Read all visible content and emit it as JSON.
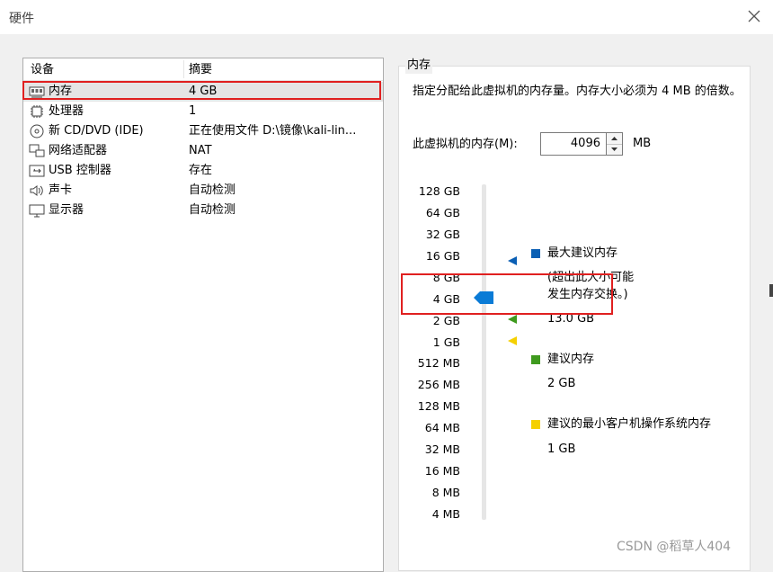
{
  "window": {
    "title": "硬件",
    "close_glyph": "✕"
  },
  "device_list": {
    "col_device": "设备",
    "col_summary": "摘要",
    "items": [
      {
        "name": "内存",
        "summary": "4 GB",
        "icon": "memory-icon"
      },
      {
        "name": "处理器",
        "summary": "1",
        "icon": "processor-icon"
      },
      {
        "name": "新 CD/DVD (IDE)",
        "summary": "正在使用文件 D:\\镜像\\kali-lin...",
        "icon": "cd-dvd-icon"
      },
      {
        "name": "网络适配器",
        "summary": "NAT",
        "icon": "network-icon"
      },
      {
        "name": "USB 控制器",
        "summary": "存在",
        "icon": "usb-icon"
      },
      {
        "name": "声卡",
        "summary": "自动检测",
        "icon": "speaker-icon"
      },
      {
        "name": "显示器",
        "summary": "自动检测",
        "icon": "monitor-icon"
      }
    ]
  },
  "memory": {
    "group_title": "内存",
    "description": "指定分配给此虚拟机的内存量。内存大小必须为 4 MB 的倍数。",
    "field_label": "此虚拟机的内存(M):",
    "value": "4096",
    "unit": "MB",
    "slider_ticks": [
      "128 GB",
      "64 GB",
      "32 GB",
      "16 GB",
      "8 GB",
      "4 GB",
      "2 GB",
      "1 GB",
      "512 MB",
      "256 MB",
      "128 MB",
      "64 MB",
      "32 MB",
      "16 MB",
      "8 MB",
      "4 MB"
    ],
    "legend": {
      "max_title": "最大建议内存",
      "max_note_1": "(超出此大小可能",
      "max_note_2": "发生内存交换。)",
      "max_value": "13.0 GB",
      "rec_title": "建议内存",
      "rec_value": "2 GB",
      "min_title": "建议的最小客户机操作系统内存",
      "min_value": "1 GB"
    },
    "colors": {
      "max": "#0a5fb4",
      "recommended": "#3f9a1e",
      "minimum": "#f5d000",
      "thumb": "#0a7bd6"
    }
  },
  "watermark": "CSDN @稻草人404"
}
